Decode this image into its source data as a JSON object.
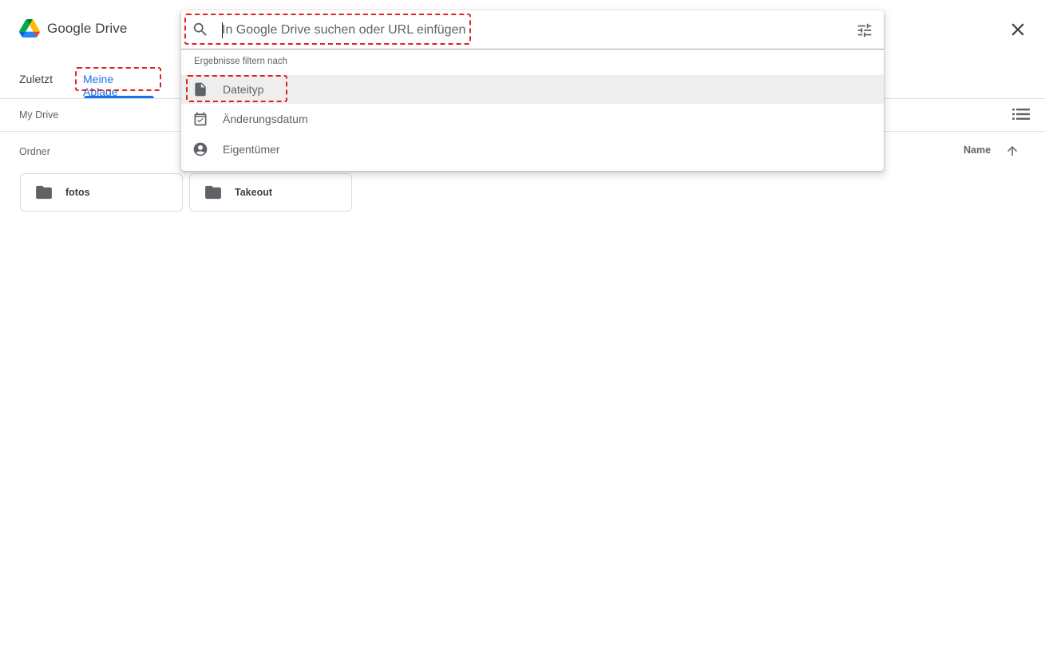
{
  "app": {
    "title": "Google Drive"
  },
  "tabs": [
    {
      "label": "Zuletzt",
      "active": false
    },
    {
      "label": "Meine Ablage",
      "active": true
    }
  ],
  "breadcrumb": "My Drive",
  "section": {
    "label": "Ordner",
    "sort_label": "Name",
    "sort_direction": "ascending"
  },
  "folders": [
    {
      "name": "fotos",
      "icon": "folder-icon"
    },
    {
      "name": "Takeout",
      "icon": "folder-icon"
    }
  ],
  "search": {
    "placeholder": "In Google Drive suchen oder URL einfügen",
    "value": "",
    "filter_header": "Ergebnisse filtern nach",
    "filters": [
      {
        "label": "Dateityp",
        "icon": "file-icon",
        "hovered": true
      },
      {
        "label": "Änderungsdatum",
        "icon": "calendar-icon",
        "hovered": false
      },
      {
        "label": "Eigentümer",
        "icon": "account-circle-icon",
        "hovered": false
      }
    ]
  },
  "colors": {
    "accent": "#1a73e8",
    "highlight": "#e02020",
    "text": "#3c4043",
    "muted": "#5f6368",
    "hover_row": "#eeeeee"
  }
}
